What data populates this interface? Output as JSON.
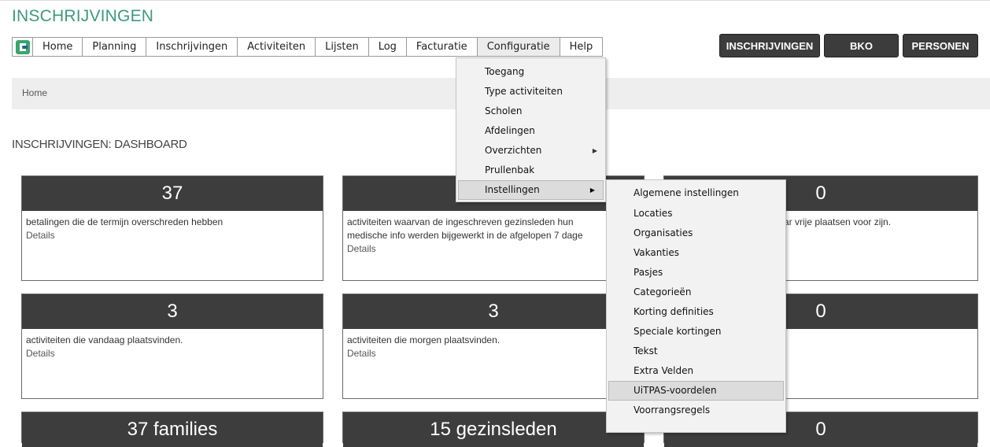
{
  "app": {
    "title": "INSCHRIJVINGEN"
  },
  "nav": {
    "items": [
      "Home",
      "Planning",
      "Inschrijvingen",
      "Activiteiten",
      "Lijsten",
      "Log",
      "Facturatie",
      "Configuratie",
      "Help"
    ],
    "active": "Configuratie"
  },
  "context_buttons": [
    "INSCHRIJVINGEN",
    "BKO",
    "PERSONEN"
  ],
  "breadcrumb": {
    "home": "Home"
  },
  "dashboard": {
    "title": "INSCHRIJVINGEN: DASHBOARD",
    "cards": [
      {
        "value": "37",
        "description": "betalingen die de termijn overschreden hebben",
        "description2": "",
        "details": "Details"
      },
      {
        "value": "",
        "description": "activiteiten waarvan de ingeschreven gezinsleden hun",
        "description2": "medische info werden bijgewerkt in de afgelopen 7 dage",
        "details": "Details"
      },
      {
        "value": "0",
        "description": "t waar vrije plaatsen voor zijn.",
        "description2": "",
        "details": ""
      },
      {
        "value": "3",
        "description": "activiteiten die vandaag plaatsvinden.",
        "description2": "",
        "details": "Details"
      },
      {
        "value": "3",
        "description": "activiteiten die morgen plaatsvinden.",
        "description2": "",
        "details": "Details"
      },
      {
        "value": "0",
        "description": "",
        "description2": "",
        "details": ""
      },
      {
        "value": "37 families",
        "description": "",
        "description2": "",
        "details": ""
      },
      {
        "value": "15 gezinsleden",
        "description": "",
        "description2": "",
        "details": ""
      },
      {
        "value": "0",
        "description": "",
        "description2": "",
        "details": ""
      }
    ]
  },
  "config_menu": {
    "items": [
      {
        "label": "Toegang",
        "submenu": false
      },
      {
        "label": "Type activiteiten",
        "submenu": false
      },
      {
        "label": "Scholen",
        "submenu": false
      },
      {
        "label": "Afdelingen",
        "submenu": false
      },
      {
        "label": "Overzichten",
        "submenu": true
      },
      {
        "label": "Prullenbak",
        "submenu": false
      },
      {
        "label": "Instellingen",
        "submenu": true
      }
    ],
    "highlighted": "Instellingen"
  },
  "settings_menu": {
    "items": [
      "Algemene instellingen",
      "Locaties",
      "Organisaties",
      "Vakanties",
      "Pasjes",
      "Categorieën",
      "Korting definities",
      "Speciale kortingen",
      "Tekst",
      "Extra Velden",
      "UiTPAS-voordelen",
      "Voorrangsregels"
    ],
    "highlighted": "UiTPAS-voordelen"
  },
  "colors": {
    "accent": "#3d9a7e",
    "card_header": "#3d3d3d",
    "button_dark": "#3c3c3c",
    "logo_green": "#3aa56c",
    "logo_blue": "#2a5f9e"
  }
}
